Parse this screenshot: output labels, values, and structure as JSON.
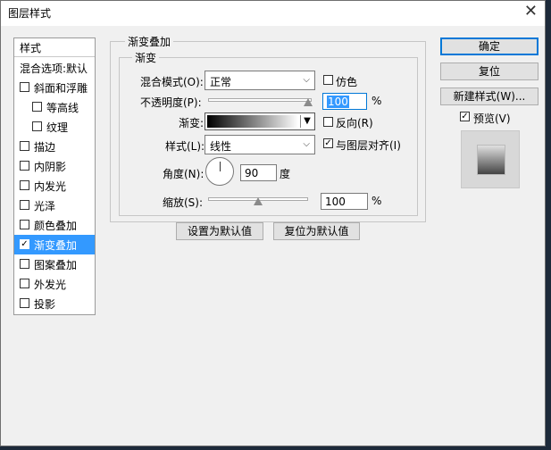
{
  "window": {
    "title": "图层样式",
    "close": "✕"
  },
  "styles_list": {
    "header": "样式",
    "blend_options": "混合选项:默认",
    "items": [
      {
        "label": "斜面和浮雕",
        "checked": false
      },
      {
        "label": "等高线",
        "checked": false
      },
      {
        "label": "纹理",
        "checked": false
      },
      {
        "label": "描边",
        "checked": false
      },
      {
        "label": "内阴影",
        "checked": false
      },
      {
        "label": "内发光",
        "checked": false
      },
      {
        "label": "光泽",
        "checked": false
      },
      {
        "label": "颜色叠加",
        "checked": false
      },
      {
        "label": "渐变叠加",
        "checked": true
      },
      {
        "label": "图案叠加",
        "checked": false
      },
      {
        "label": "外发光",
        "checked": false
      },
      {
        "label": "投影",
        "checked": false
      }
    ]
  },
  "panel": {
    "outer_title": "渐变叠加",
    "inner_title": "渐变",
    "blend_mode": {
      "label": "混合模式(O):",
      "value": "正常"
    },
    "dither": {
      "label": "仿色",
      "checked": false
    },
    "opacity": {
      "label": "不透明度(P):",
      "value": "100",
      "unit": "%",
      "level": 1.0
    },
    "gradient": {
      "label": "渐变:"
    },
    "reverse": {
      "label": "反向(R)",
      "checked": false
    },
    "style": {
      "label": "样式(L):",
      "value": "线性"
    },
    "align": {
      "label": "与图层对齐(I)",
      "checked": true
    },
    "angle": {
      "label": "角度(N):",
      "value": "90",
      "unit": "度"
    },
    "scale": {
      "label": "缩放(S):",
      "value": "100",
      "unit": "%",
      "level": 0.5
    },
    "set_default": "设置为默认值",
    "reset_default": "复位为默认值"
  },
  "right": {
    "ok": "确定",
    "reset": "复位",
    "new_style": "新建样式(W)...",
    "preview": {
      "label": "预览(V)",
      "checked": true
    }
  },
  "colors": {
    "selection": "#3399ff",
    "primary_border": "#0078d7"
  },
  "check_mark": "✓"
}
